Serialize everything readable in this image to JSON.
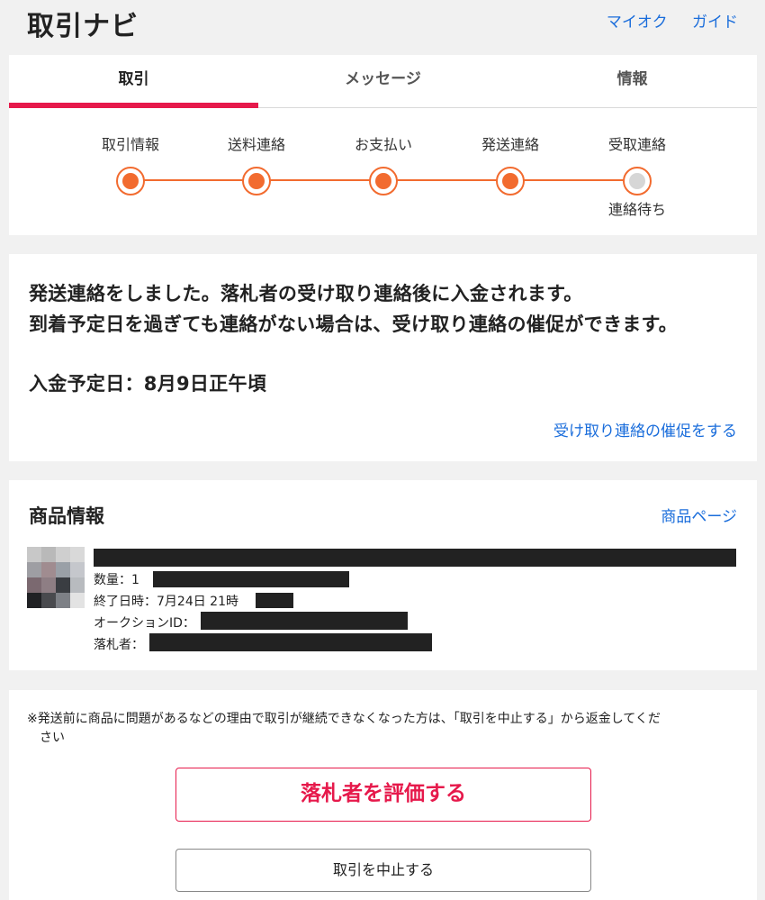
{
  "header": {
    "title": "取引ナビ",
    "links": [
      "マイオク",
      "ガイド"
    ]
  },
  "tabs": [
    {
      "label": "取引",
      "active": true
    },
    {
      "label": "メッセージ",
      "active": false
    },
    {
      "label": "情報",
      "active": false
    }
  ],
  "progress": {
    "steps": [
      {
        "label": "取引情報",
        "state": "done"
      },
      {
        "label": "送料連絡",
        "state": "done"
      },
      {
        "label": "お支払い",
        "state": "done"
      },
      {
        "label": "発送連絡",
        "state": "done"
      },
      {
        "label": "受取連絡",
        "state": "pending",
        "status": "連絡待ち"
      }
    ],
    "accent_color": "#f26b2f",
    "pending_color": "#d6d6d6"
  },
  "notice": {
    "line1": "発送連絡をしました。落札者の受け取り連絡後に入金されます。",
    "line2": "到着予定日を過ぎても連絡がない場合は、受け取り連絡の催促ができます。",
    "payment_date": "入金予定日：8月9日正午頃",
    "remind_link": "受け取り連絡の催促をする"
  },
  "item": {
    "heading": "商品情報",
    "page_link": "商品ページ",
    "quantity_label": "数量：1",
    "end_date_label": "終了日時：7月24日 21時",
    "auction_id_label": "オークションID：",
    "winner_label": "落札者："
  },
  "actions": {
    "disclaimer_line1": "※発送前に商品に問題があるなどの理由で取引が継続できなくなった方は、「取引を中止する」から返金してくだ",
    "disclaimer_line2": "さい",
    "rate_button": "落札者を評価する",
    "cancel_button": "取引を中止する"
  },
  "colors": {
    "brand_red": "#e6194b",
    "link_blue": "#1a6ddb"
  }
}
